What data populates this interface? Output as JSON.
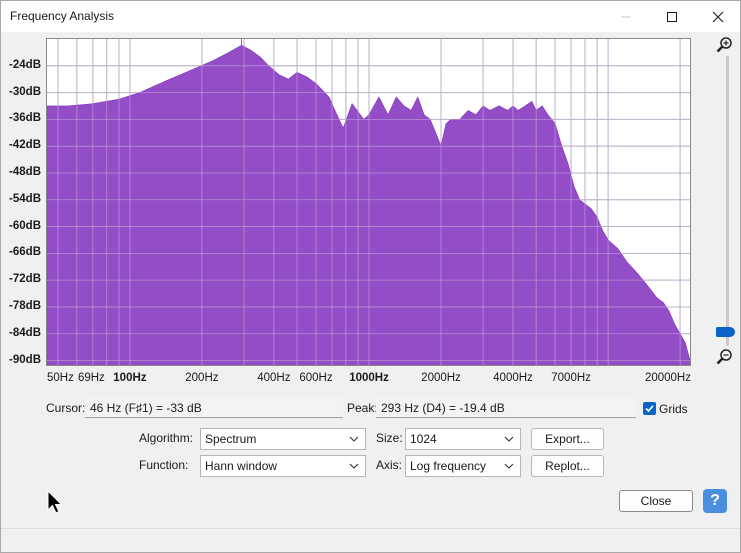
{
  "window": {
    "title": "Frequency Analysis"
  },
  "colors": {
    "spectrum": "#8a3ec2",
    "cursor_line": "#e04040",
    "grid": "#b0b0b0",
    "accent": "#0a64c8"
  },
  "chart_data": {
    "type": "area",
    "x_scale": "log",
    "xlim": [
      45,
      22000
    ],
    "ylim": [
      -91,
      -18
    ],
    "y_ticks": [
      "-24dB",
      "-30dB",
      "-36dB",
      "-42dB",
      "-48dB",
      "-54dB",
      "-60dB",
      "-66dB",
      "-72dB",
      "-78dB",
      "-84dB",
      "-90dB"
    ],
    "y_tick_values": [
      -24,
      -30,
      -36,
      -42,
      -48,
      -54,
      -60,
      -66,
      -72,
      -78,
      -84,
      -90
    ],
    "x_ticks": [
      "50Hz",
      "69Hz",
      "100Hz",
      "200Hz",
      "400Hz",
      "600Hz",
      "1000Hz",
      "2000Hz",
      "4000Hz",
      "7000Hz",
      "20000Hz"
    ],
    "x_tick_values": [
      50,
      69,
      100,
      200,
      400,
      600,
      1000,
      2000,
      4000,
      7000,
      20000
    ],
    "x_tick_bold": [
      false,
      false,
      true,
      false,
      false,
      false,
      true,
      false,
      false,
      false,
      false
    ],
    "cursor_freq": 293,
    "series": [
      {
        "x": [
          45,
          55,
          70,
          90,
          110,
          140,
          180,
          220,
          260,
          293,
          320,
          350,
          380,
          420,
          460,
          500,
          550,
          600,
          680,
          720,
          780,
          850,
          950,
          1000,
          1100,
          1200,
          1300,
          1400,
          1500,
          1600,
          1700,
          1800,
          1900,
          2000,
          2100,
          2200,
          2400,
          2600,
          2800,
          3000,
          3200,
          3500,
          3800,
          4000,
          4200,
          4500,
          4800,
          5000,
          5300,
          5600,
          6000,
          6400,
          6800,
          7200,
          7600,
          8000,
          8500,
          9000,
          9500,
          10000,
          11000,
          12000,
          13000,
          14000,
          15000,
          16000,
          17000,
          18000,
          19000,
          20000,
          21000,
          22000
        ],
        "y": [
          -33,
          -33,
          -32.5,
          -31.5,
          -30,
          -27.5,
          -25,
          -23,
          -21,
          -19.4,
          -20.5,
          -22,
          -24,
          -26,
          -27,
          -25.5,
          -26.5,
          -28,
          -31,
          -34,
          -38,
          -32.5,
          -36,
          -35,
          -31,
          -35,
          -31,
          -33,
          -34,
          -31,
          -35,
          -36,
          -39,
          -42,
          -37,
          -36,
          -36,
          -34,
          -35,
          -33,
          -34,
          -33,
          -34,
          -33,
          -34,
          -33,
          -32,
          -34,
          -33,
          -35,
          -37,
          -42,
          -46,
          -51,
          -54,
          -55,
          -56,
          -58,
          -61,
          -63,
          -65,
          -68,
          -70,
          -72,
          -74,
          -76,
          -77,
          -79,
          -82,
          -84,
          -86,
          -90
        ]
      }
    ]
  },
  "readouts": {
    "cursor_label": "Cursor:",
    "cursor_value": "46 Hz (F♯1) = -33 dB",
    "peak_label": "Peak:",
    "peak_value": "293 Hz (D4) = -19.4 dB",
    "grids_label": "Grids"
  },
  "controls": {
    "algorithm_label": "Algorithm:",
    "algorithm_value": "Spectrum",
    "size_label": "Size:",
    "size_value": "1024",
    "function_label": "Function:",
    "function_value": "Hann window",
    "axis_label": "Axis:",
    "axis_value": "Log frequency",
    "export_label": "Export...",
    "replot_label": "Replot...",
    "close_label": "Close",
    "help_label": "?"
  },
  "icons": {
    "zoom_in": "zoom-in-icon",
    "zoom_out": "zoom-out-icon",
    "help": "help-icon"
  }
}
